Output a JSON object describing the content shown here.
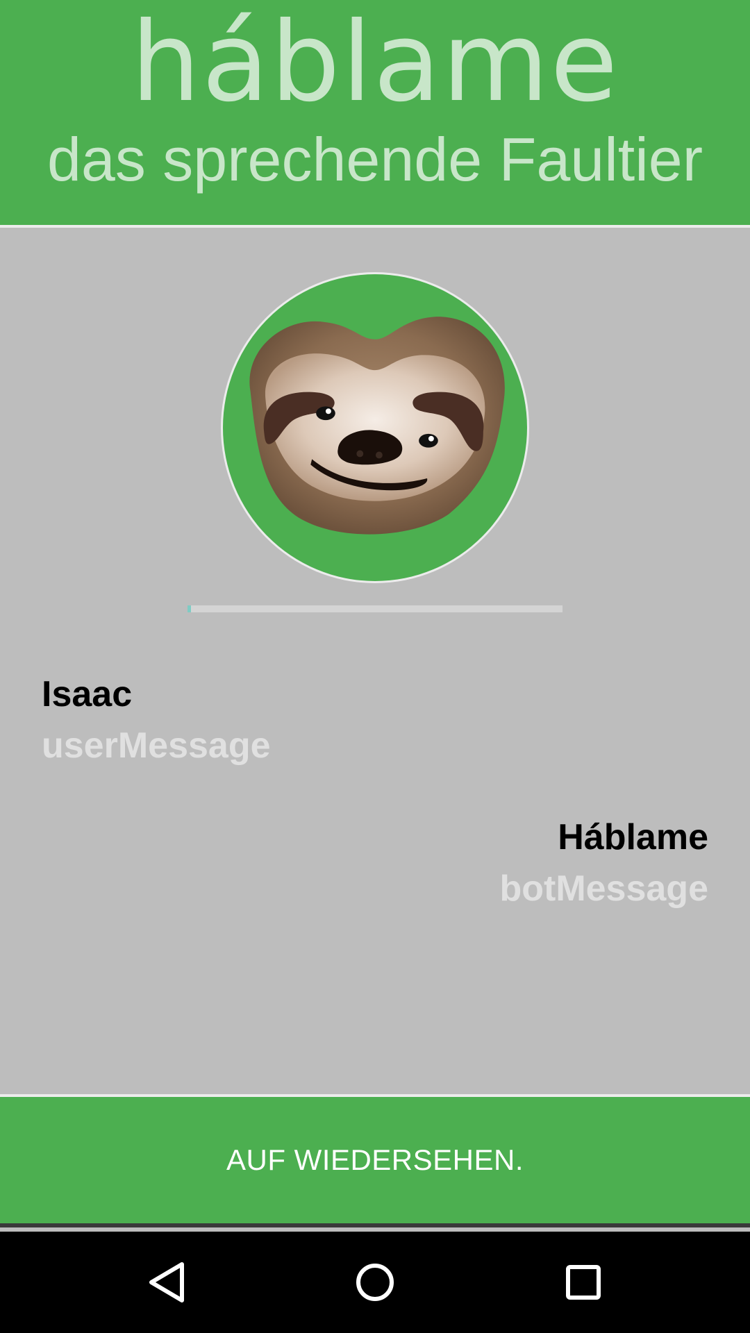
{
  "header": {
    "logo_text": "háblame",
    "subtitle": "das sprechende Faultier"
  },
  "avatar": {
    "icon": "sloth-face-icon"
  },
  "progress": {
    "value_percent": 1
  },
  "conversation": {
    "user": {
      "name": "Isaac",
      "message": "userMessage"
    },
    "bot": {
      "name": "Háblame",
      "message": "botMessage"
    }
  },
  "bottom_button": {
    "label": "AUF WIEDERSEHEN."
  },
  "navbar": {
    "back_icon": "back-triangle-icon",
    "home_icon": "home-circle-icon",
    "recents_icon": "recents-square-icon"
  },
  "colors": {
    "primary_green": "#4caf50",
    "light_green_text": "#c8e6c9",
    "background_gray": "#bdbdbd",
    "progress_accent": "#80cbc4"
  }
}
